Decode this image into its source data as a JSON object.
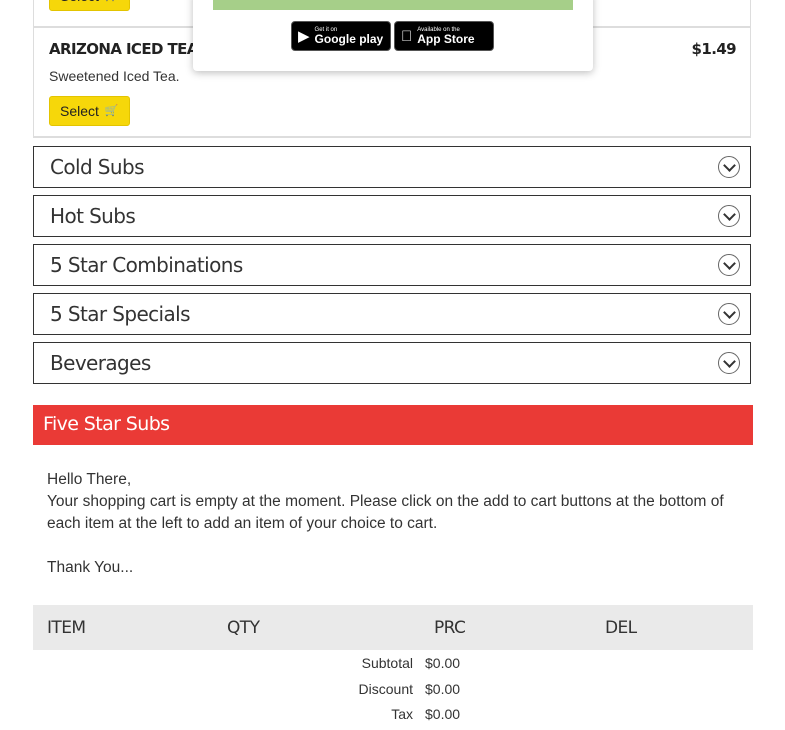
{
  "top_item": {
    "select_label": "Select"
  },
  "modal": {
    "google_play": {
      "small": "Get it on",
      "big": "Google play"
    },
    "app_store": {
      "small": "Available on the",
      "big": "App Store"
    }
  },
  "item": {
    "name": "ARIZONA ICED TEA",
    "description": "Sweetened Iced Tea.",
    "price": "$1.49",
    "select_label": "Select"
  },
  "categories": [
    {
      "label": "Cold Subs"
    },
    {
      "label": "Hot Subs"
    },
    {
      "label": "5 Star Combinations"
    },
    {
      "label": "5 Star Specials"
    },
    {
      "label": "Beverages"
    }
  ],
  "cart": {
    "title": "Five Star Subs",
    "greeting": "Hello There,",
    "message": "Your shopping cart is empty at the moment. Please click on the add to cart buttons at the bottom of each item at the left to add an item of your choice to cart.",
    "signoff": "Thank You...",
    "columns": {
      "item": "ITEM",
      "qty": "QTY",
      "prc": "PRC",
      "del": "DEL"
    },
    "totals": [
      {
        "label": "Subtotal",
        "value": "$0.00"
      },
      {
        "label": "Discount",
        "value": "$0.00"
      },
      {
        "label": "Tax",
        "value": "$0.00"
      }
    ]
  },
  "colors": {
    "accent_yellow": "#f6d70a",
    "cart_header_red": "#ea3a36",
    "modal_bar_green": "#a6cf89"
  }
}
